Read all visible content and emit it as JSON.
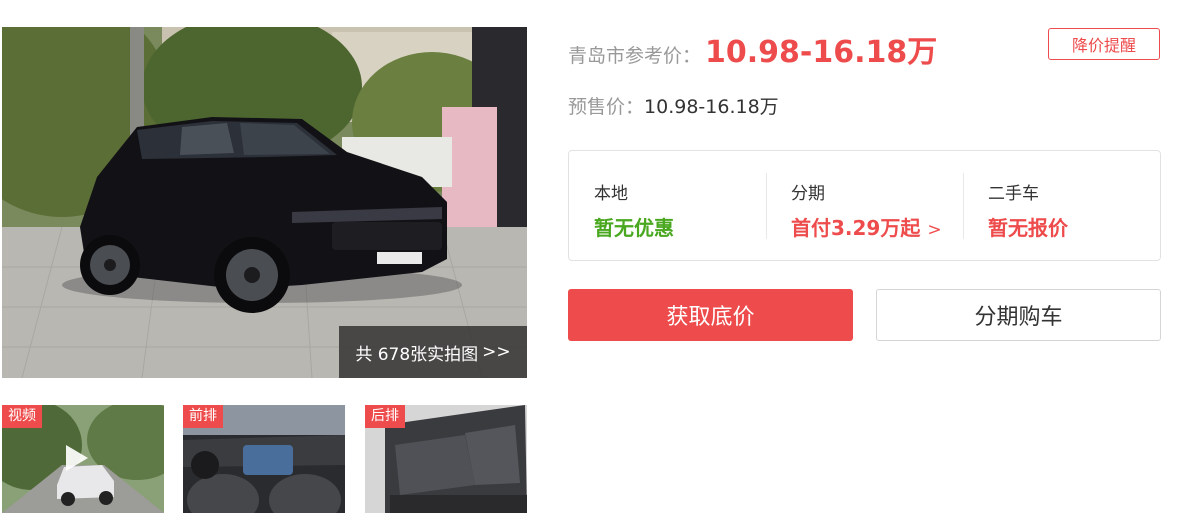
{
  "gallery": {
    "photo_count_label": "共 678张实拍图",
    "photo_count_arrow": ">>",
    "thumbnails": [
      {
        "tag": "视频"
      },
      {
        "tag": "前排"
      },
      {
        "tag": "后排"
      }
    ]
  },
  "pricing": {
    "reference_label": "青岛市参考价：",
    "reference_value": "10.98-16.18万",
    "alert_button": "降价提醒",
    "presale_label": "预售价：",
    "presale_value": "10.98-16.18万"
  },
  "offers": [
    {
      "title": "本地",
      "value": "暂无优惠"
    },
    {
      "title": "分期",
      "value": "首付3.29万起",
      "arrow": ">"
    },
    {
      "title": "二手车",
      "value": "暂无报价"
    }
  ],
  "actions": {
    "primary": "获取底价",
    "secondary": "分期购车"
  },
  "colors": {
    "accent": "#ee4c4c",
    "green": "#49a820"
  }
}
